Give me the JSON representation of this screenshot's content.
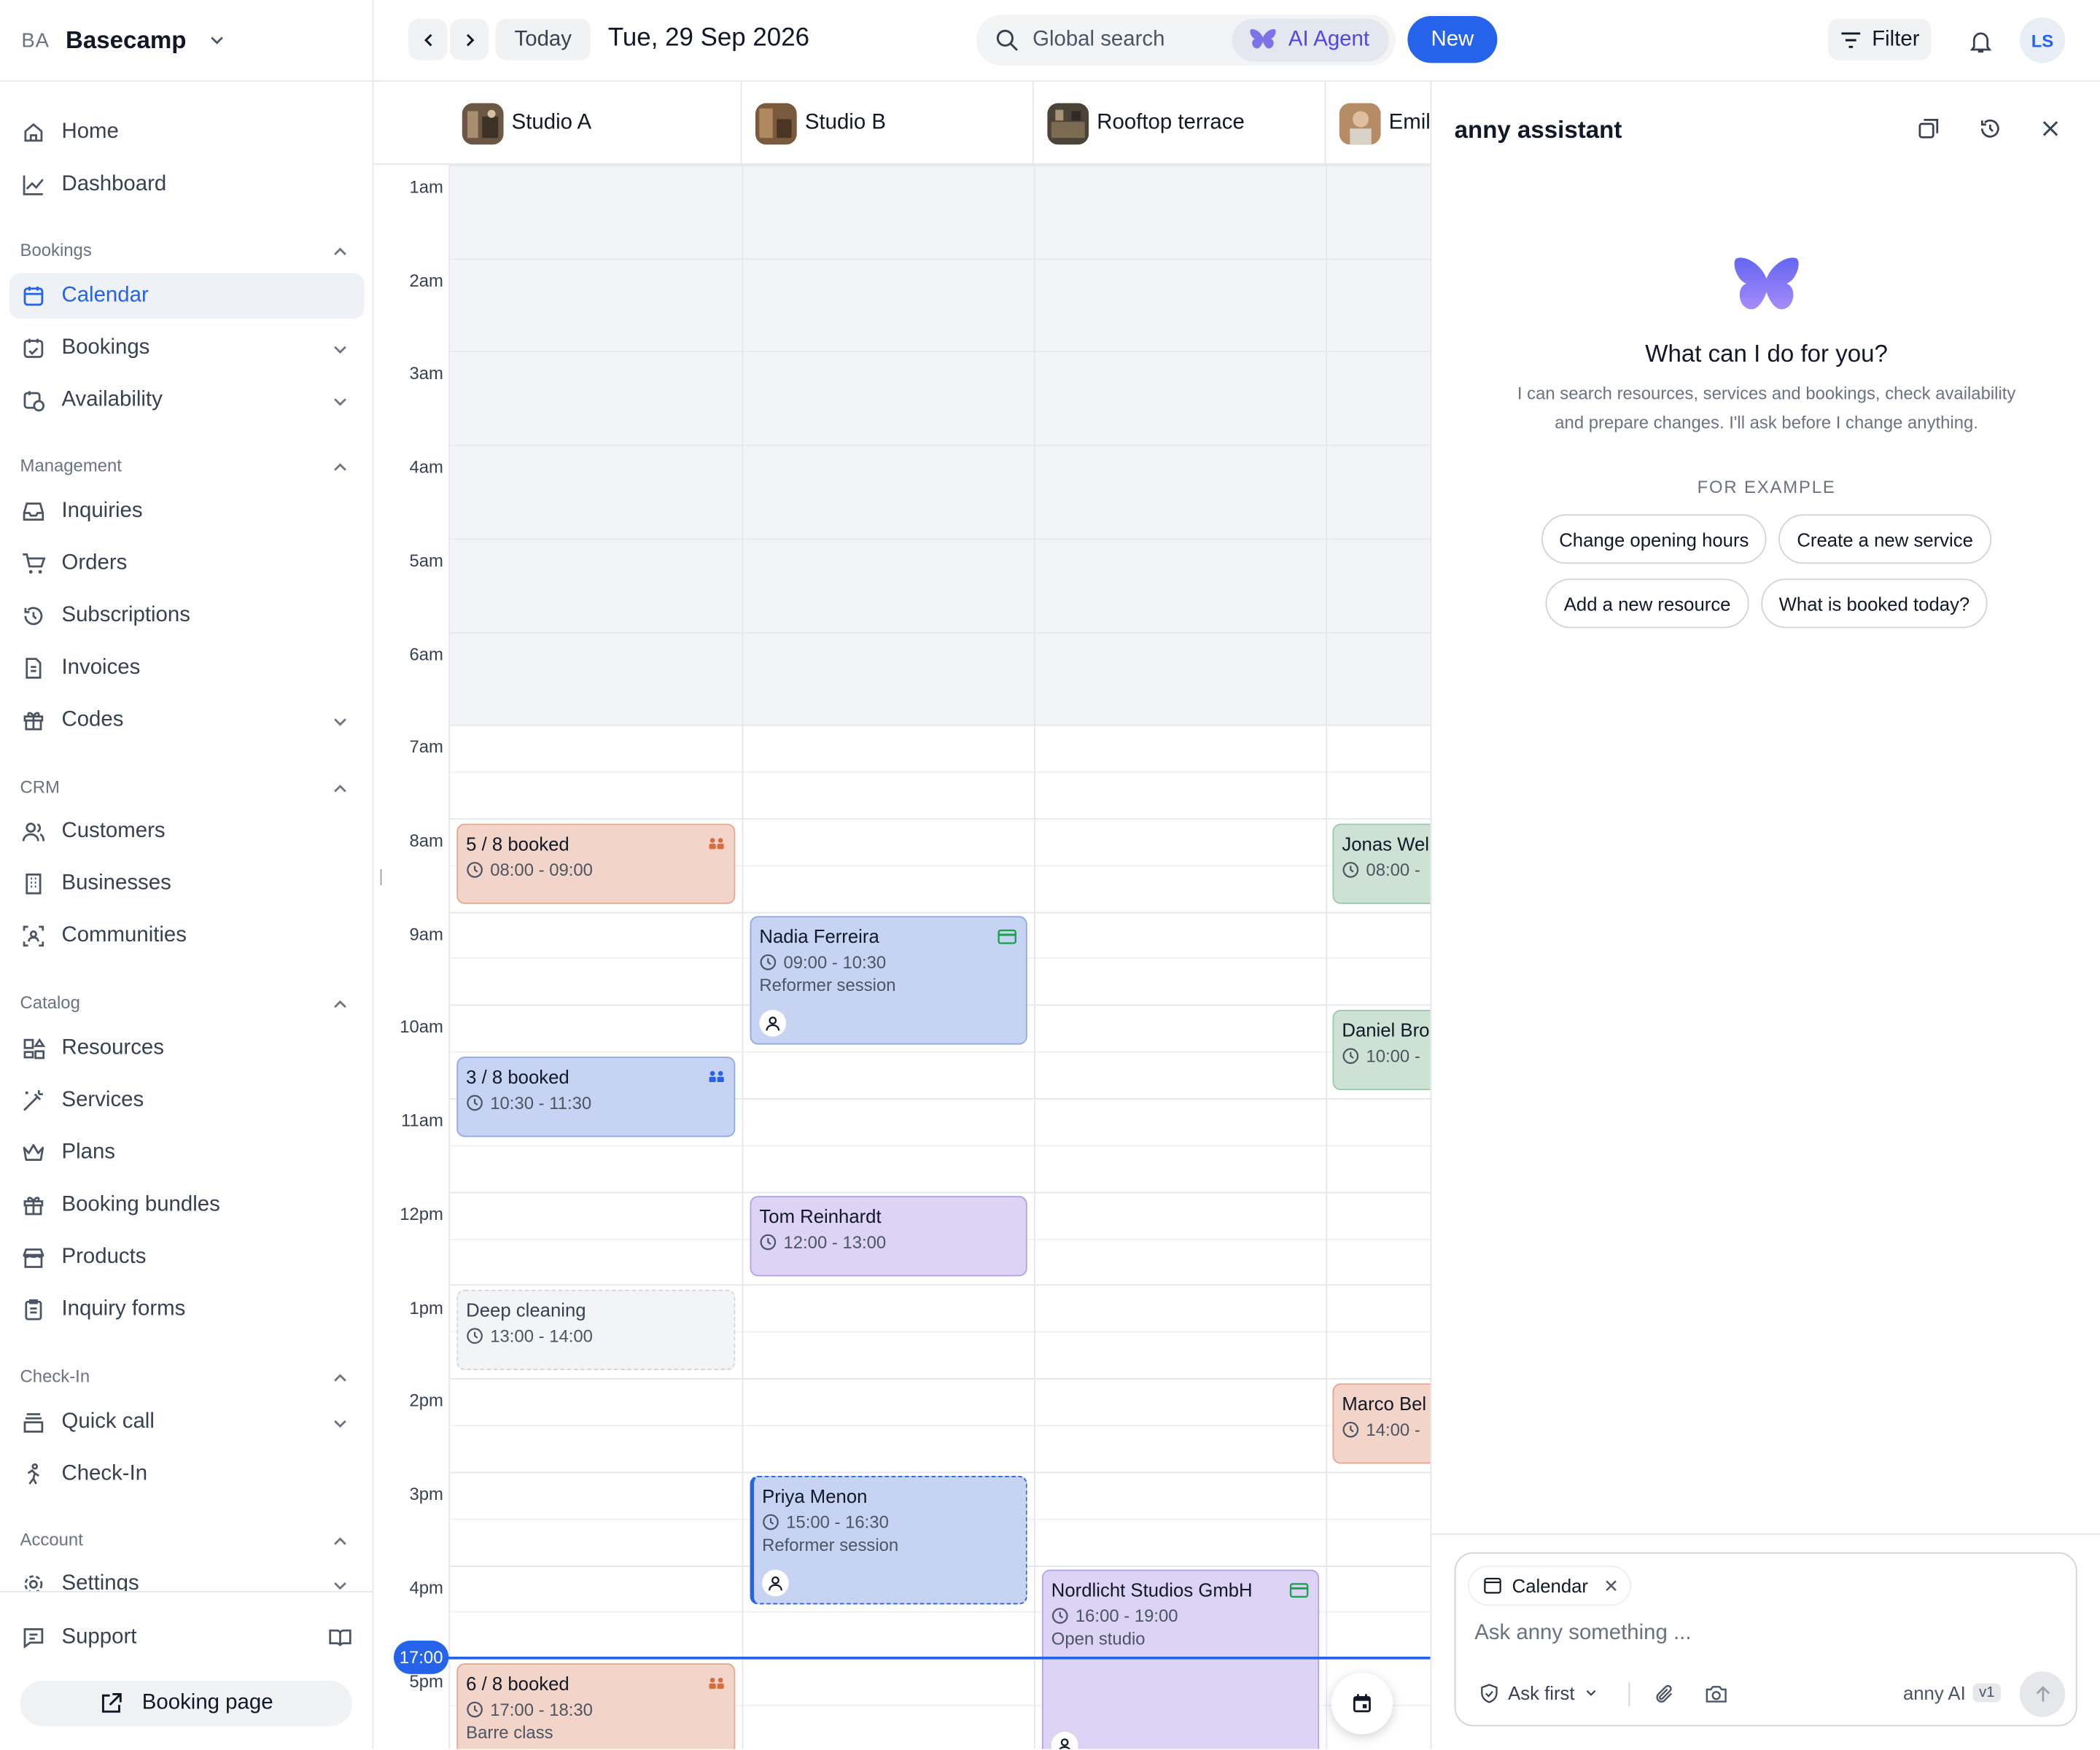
{
  "workspace": {
    "badge": "BA",
    "name": "Basecamp"
  },
  "nav": {
    "home": "Home",
    "dashboard": "Dashboard",
    "sec_bookings": "Bookings",
    "calendar": "Calendar",
    "bookings": "Bookings",
    "availability": "Availability",
    "sec_management": "Management",
    "inquiries": "Inquiries",
    "orders": "Orders",
    "subscriptions": "Subscriptions",
    "invoices": "Invoices",
    "codes": "Codes",
    "sec_crm": "CRM",
    "customers": "Customers",
    "businesses": "Businesses",
    "communities": "Communities",
    "sec_catalog": "Catalog",
    "resources": "Resources",
    "services": "Services",
    "plans": "Plans",
    "booking_bundles": "Booking bundles",
    "products": "Products",
    "inquiry_forms": "Inquiry forms",
    "sec_checkin": "Check-In",
    "quick_call": "Quick call",
    "checkin": "Check-In",
    "sec_account": "Account",
    "settings": "Settings",
    "support": "Support",
    "booking_page": "Booking page"
  },
  "toolbar": {
    "today": "Today",
    "date": "Tue, 29 Sep 2026",
    "search_placeholder": "Global search",
    "ai_agent": "AI Agent",
    "new": "New",
    "filter": "Filter",
    "user_initials": "LS"
  },
  "resources": [
    "Studio A",
    "Studio B",
    "Rooftop terrace",
    "Emil"
  ],
  "hours": [
    "1am",
    "2am",
    "3am",
    "4am",
    "5am",
    "6am",
    "7am",
    "8am",
    "9am",
    "10am",
    "11am",
    "12pm",
    "1pm",
    "2pm",
    "3pm",
    "4pm",
    "5pm"
  ],
  "now_label": "17:00",
  "events": {
    "e1": {
      "title": "5 / 8 booked",
      "time": "08:00 - 09:00"
    },
    "e2": {
      "title": "3 / 8 booked",
      "time": "10:30 - 11:30"
    },
    "e3": {
      "title": "Deep cleaning",
      "time": "13:00 - 14:00"
    },
    "e4": {
      "title": "6 / 8 booked",
      "time": "17:00 - 18:30",
      "sub": "Barre class"
    },
    "e5": {
      "title": "Nadia Ferreira",
      "time": "09:00 - 10:30",
      "sub": "Reformer session"
    },
    "e6": {
      "title": "Tom Reinhardt",
      "time": "12:00 - 13:00"
    },
    "e7": {
      "title": "Priya Menon",
      "time": "15:00 - 16:30",
      "sub": "Reformer session"
    },
    "e8": {
      "title": "Nordlicht Studios GmbH",
      "time": "16:00 - 19:00",
      "sub": "Open studio"
    },
    "e9": {
      "title": "Jonas Wel",
      "time": "08:00 - "
    },
    "e10": {
      "title": "Daniel Bro",
      "time": "10:00 - "
    },
    "e11": {
      "title": "Marco Bel",
      "time": "14:00 - "
    }
  },
  "assistant": {
    "title": "anny assistant",
    "heading": "What can I do for you?",
    "desc1": "I can search resources, services and bookings, check availability",
    "desc2": "and prepare changes. I'll ask before I change anything.",
    "example_label": "FOR EXAMPLE",
    "examples": [
      "Change opening hours",
      "Create a new service",
      "Add a new resource",
      "What is booked today?"
    ],
    "context_chip": "Calendar",
    "input_placeholder": "Ask anny something ...",
    "mode": "Ask first",
    "model": "anny AI",
    "version": "v1"
  }
}
